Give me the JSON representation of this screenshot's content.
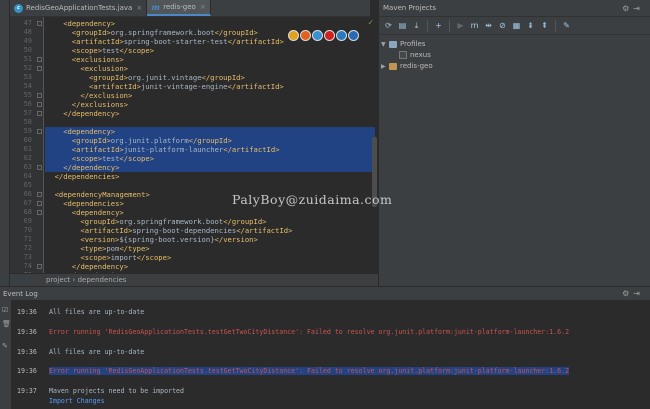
{
  "tabs": [
    {
      "label": "RedisGeoApplicationTests.java",
      "icon": "c",
      "color": "#3592c4"
    },
    {
      "label": "redis-geo",
      "icon": "m",
      "color": "#4a88c7"
    }
  ],
  "editor": {
    "lines": [
      {
        "n": "47",
        "indent": 4,
        "text": "<dependency>"
      },
      {
        "n": "48",
        "indent": 6,
        "text": "<groupId>org.springframework.boot</groupId>"
      },
      {
        "n": "49",
        "indent": 6,
        "text": "<artifactId>spring-boot-starter-test</artifactId>"
      },
      {
        "n": "50",
        "indent": 6,
        "text": "<scope>test</scope>"
      },
      {
        "n": "51",
        "indent": 6,
        "text": "<exclusions>"
      },
      {
        "n": "52",
        "indent": 8,
        "text": "<exclusion>"
      },
      {
        "n": "53",
        "indent": 10,
        "text": "<groupId>org.junit.vintage</groupId>"
      },
      {
        "n": "54",
        "indent": 10,
        "text": "<artifactId>junit-vintage-engine</artifactId>"
      },
      {
        "n": "55",
        "indent": 8,
        "text": "</exclusion>"
      },
      {
        "n": "56",
        "indent": 6,
        "text": "</exclusions>"
      },
      {
        "n": "57",
        "indent": 4,
        "text": "</dependency>"
      },
      {
        "n": "58",
        "indent": 0,
        "text": ""
      },
      {
        "n": "59",
        "indent": 4,
        "text": "<dependency>"
      },
      {
        "n": "60",
        "indent": 6,
        "text": "<groupId>org.junit.platform</groupId>"
      },
      {
        "n": "61",
        "indent": 6,
        "text": "<artifactId>junit-platform-launcher</artifactId>"
      },
      {
        "n": "62",
        "indent": 6,
        "text": "<scope>test</scope>"
      },
      {
        "n": "63",
        "indent": 4,
        "text": "</dependency>"
      },
      {
        "n": "64",
        "indent": 2,
        "text": "</dependencies>"
      },
      {
        "n": "65",
        "indent": 0,
        "text": ""
      },
      {
        "n": "66",
        "indent": 2,
        "text": "<dependencyManagement>"
      },
      {
        "n": "67",
        "indent": 4,
        "text": "<dependencies>"
      },
      {
        "n": "68",
        "indent": 6,
        "text": "<dependency>"
      },
      {
        "n": "69",
        "indent": 8,
        "text": "<groupId>org.springframework.boot</groupId>"
      },
      {
        "n": "70",
        "indent": 8,
        "text": "<artifactId>spring-boot-dependencies</artifactId>"
      },
      {
        "n": "71",
        "indent": 8,
        "text": "<version>${spring-boot.version}</version>"
      },
      {
        "n": "72",
        "indent": 8,
        "text": "<type>pom</type>"
      },
      {
        "n": "73",
        "indent": 8,
        "text": "<scope>import</scope>"
      },
      {
        "n": "74",
        "indent": 6,
        "text": "</dependency>"
      },
      {
        "n": "75",
        "indent": 4,
        "text": "</dependencies>"
      }
    ],
    "selected_lines": [
      "59",
      "60",
      "61",
      "62",
      "63"
    ],
    "browser_icons": [
      {
        "name": "chrome-icon",
        "color": "#e0a020"
      },
      {
        "name": "firefox-icon",
        "color": "#e06020"
      },
      {
        "name": "safari-icon",
        "color": "#3a90d0"
      },
      {
        "name": "opera-icon",
        "color": "#d02020"
      },
      {
        "name": "ie-icon",
        "color": "#2a7ac0"
      },
      {
        "name": "edge-icon",
        "color": "#2a6ab0"
      }
    ]
  },
  "breadcrumb": {
    "items": [
      "project",
      "dependencies"
    ],
    "separator": "›"
  },
  "maven": {
    "title": "Maven Projects",
    "profiles_label": "Profiles",
    "profile_item": "nexus",
    "project_label": "redis-geo"
  },
  "watermark": "PalyBoy@zuidaima.com",
  "event_log": {
    "title": "Event Log",
    "rows": [
      {
        "time": "19:36",
        "text": "All files are up-to-date",
        "kind": "info"
      },
      {
        "time": "19:36",
        "text": "Error running 'RedisGeoApplicationTests.testGetTwoCityDistance': Failed to resolve org.junit.platform:junit-platform-launcher:1.6.2",
        "kind": "error"
      },
      {
        "time": "19:36",
        "text": "All files are up-to-date",
        "kind": "info"
      },
      {
        "time": "19:36",
        "text": "Error running 'RedisGeoApplicationTests.testGetTwoCityDistance': Failed to resolve org.junit.platform:junit-platform-launcher:1.6.2",
        "kind": "error-selected"
      },
      {
        "time": "19:37",
        "text": "Maven projects need to be imported",
        "kind": "info"
      },
      {
        "time": "",
        "text": "Import Changes",
        "kind": "link"
      }
    ]
  },
  "colors": {
    "tag": "#e8bf6a",
    "selection": "#214283",
    "error": "#c75450",
    "background": "#2b2b2b",
    "panel": "#3c3f41"
  }
}
